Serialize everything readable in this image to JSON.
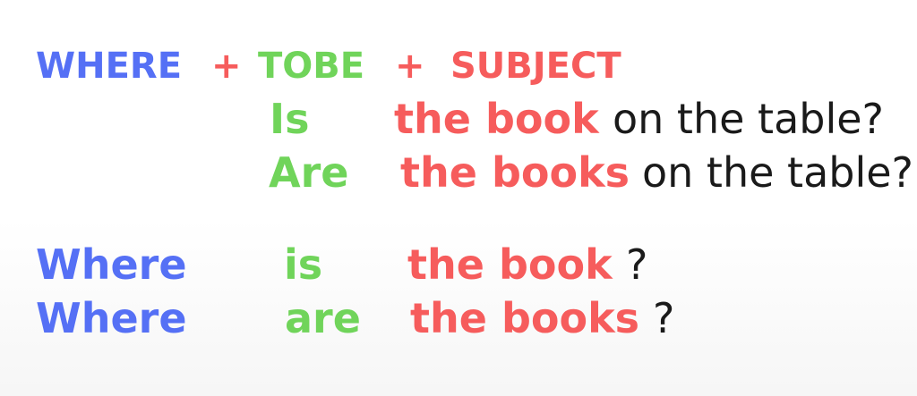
{
  "formula": {
    "where": "WHERE",
    "plus_1": "+",
    "tobe": "TOBE",
    "plus_2": "+",
    "subject": "SUBJECT"
  },
  "example_1": {
    "verb": "Is",
    "subject": "the book",
    "rest": "on the table?"
  },
  "example_2": {
    "verb": "Are",
    "subject": "the books",
    "rest": "on the table?"
  },
  "question_1": {
    "where": "Where",
    "verb": "is",
    "subject": "the book",
    "mark": "?"
  },
  "question_2": {
    "where": "Where",
    "verb": "are",
    "subject": "the books",
    "mark": "?"
  },
  "colors": {
    "where": "#5570f5",
    "tobe": "#70d45a",
    "subject": "#f65c5c",
    "text": "#1a1a1a"
  }
}
